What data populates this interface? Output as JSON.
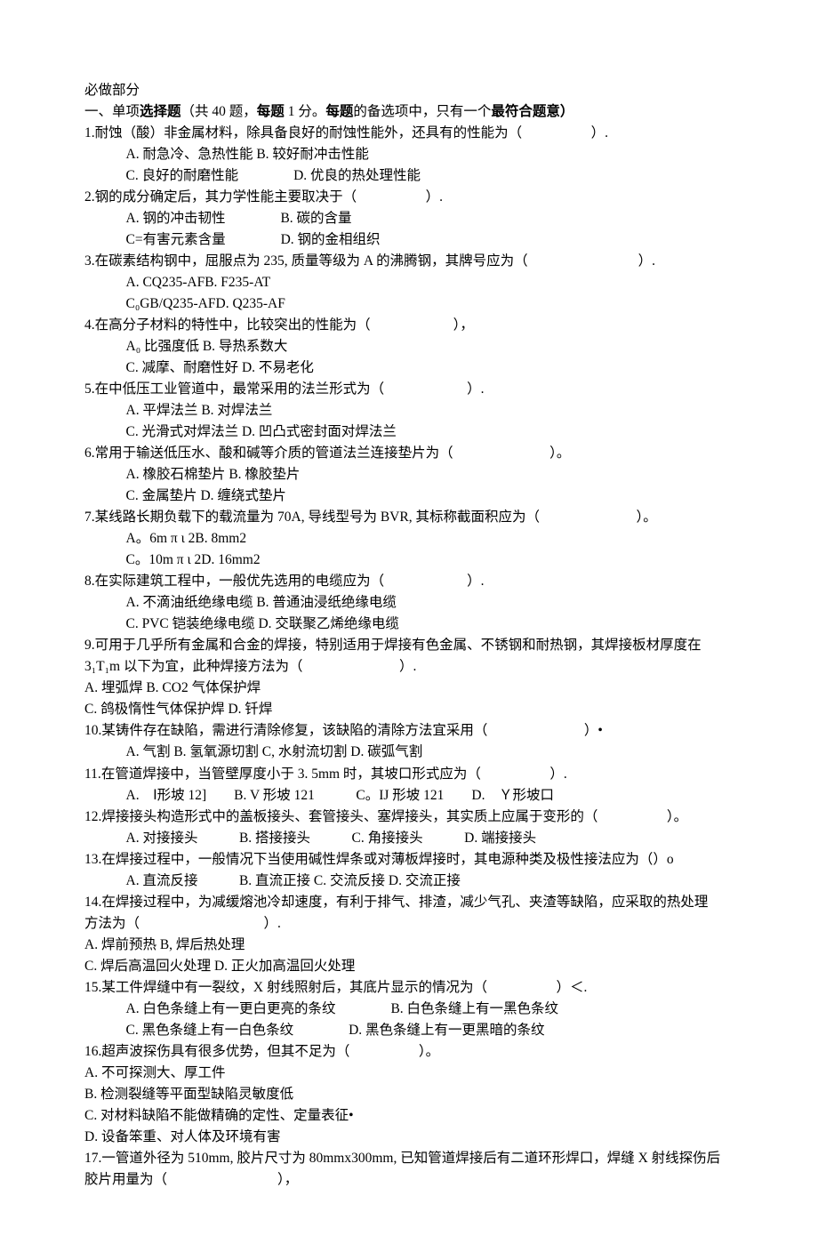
{
  "header": {
    "title": "必做部分",
    "intro_prefix": "一、单项",
    "intro_bold1": "选择题",
    "intro_mid": "（共 40 题，",
    "intro_bold2": "每题",
    "intro_mid2": " 1 分。",
    "intro_bold3": "每题",
    "intro_mid3": "的备选项中，只有一个",
    "intro_bold4": "最符合题意）"
  },
  "questions": [
    {
      "n": "1.",
      "text": "耐蚀（酸）非金属材料，除具备良好的耐蚀性能外，还具有的性能为（　　　　　）.",
      "opts": [
        "A. 耐急冷、急热性能 B. 较好耐冲击性能",
        "C. 良好的耐磨性能　　　　D. 优良的热处理性能"
      ]
    },
    {
      "n": "2.",
      "text": "钢的成分确定后，其力学性能主要取决于（　　　　　）.",
      "opts": [
        "A. 钢的冲击韧性　　　　B. 碳的含量",
        "C=有害元素含量　　　　D. 钢的金相组织"
      ]
    },
    {
      "n": "3.",
      "text": "在碳素结构钢中，屈服点为 235, 质量等级为 A 的沸腾钢，其牌号应为（　　　　　　　　）.",
      "opts": [
        "A. CQ235-AFB. F235-AT",
        "C₀GB/Q235-AFD. Q235-AF"
      ]
    },
    {
      "n": "4.",
      "text": "在高分子材料的特性中，比较突出的性能为（　　　　　　），",
      "opts": [
        "A₀ 比强度低 B. 导热系数大",
        "C. 减摩、耐磨性好 D. 不易老化"
      ]
    },
    {
      "n": "5.",
      "text": "在中低压工业管道中，最常采用的法兰形式为（　　　　　　）.",
      "opts": [
        "A. 平焊法兰 B. 对焊法兰",
        "C. 光滑式对焊法兰 D. 凹凸式密封面对焊法兰"
      ]
    },
    {
      "n": "6.",
      "text": "常用于输送低压水、酸和碱等介质的管道法兰连接垫片为（　　　　　　　）。",
      "opts": [
        "A. 橡胶石棉垫片 B. 橡胶垫片",
        "C. 金属垫片 D. 缠绕式垫片"
      ]
    },
    {
      "n": "7.",
      "text": "某线路长期负载下的载流量为 70A, 导线型号为 BVR, 其标称截面积应为（　　　　　　　）。",
      "opts": [
        "A。6m π ι 2B. 8mm2",
        "C。10m π ι 2D. 16mm2"
      ]
    },
    {
      "n": "8.",
      "text": "在实际建筑工程中，一般优先选用的电缆应为（　　　　　　）.",
      "opts": [
        "A. 不滴油纸绝缘电缆 B. 普通油浸纸绝缘电缆",
        "C. PVC 铠装绝缘电缆 D. 交联聚乙烯绝缘电缆"
      ]
    },
    {
      "n": "9.",
      "text": "可用于几乎所有金属和合金的焊接，特别适用于焊接有色金属、不锈钢和耐热钢，其焊接板材厚度在",
      "cont": "3₁T₁m 以下为宜，此种焊接方法为（　　　　　　　）.",
      "opts": [
        "A. 埋弧焊 B. CO2 气体保护焊",
        "C. 鸽极惰性气体保护焊 D. 钎焊"
      ],
      "noindent": true
    },
    {
      "n": "10.",
      "text": "某铸件存在缺陷，需进行清除修复，该缺陷的清除方法宜采用（　　　　　　　）•",
      "opts": [
        "A. 气割 B. 氢氧源切割 C, 水射流切割 D. 碳弧气割"
      ]
    },
    {
      "n": "11.",
      "text": "在管道焊接中，当管壁厚度小于 3. 5mm 时，其坡口形式应为（　　　　　）.",
      "opts": [
        "A.　Ⅰ形坡 12]　　B. V 形坡 121　　　C。IJ 形坡 121　　D.　Ｙ形坡口"
      ]
    },
    {
      "n": "12.",
      "text": "焊接接头构造形式中的盖板接头、套管接头、塞焊接头，其实质上应属于变形的（　　　　　）。",
      "opts": [
        "A. 对接接头　　　B. 搭接接头　　　C. 角接接头　　　D. 端接接头"
      ]
    },
    {
      "n": "13.",
      "text": "在焊接过程中，一般情况下当使用碱性焊条或对薄板焊接时，其电源种类及极性接法应为（）o",
      "opts": [
        "A. 直流反接　　　B. 直流正接 C. 交流反接 D. 交流正接"
      ]
    },
    {
      "n": "14.",
      "text": "在焊接过程中，为减缓熔池冷却速度，有利于排气、排渣，减少气孔、夹渣等缺陷，应采取的热处理",
      "cont": "方法为（　　　　　　　　　）.",
      "opts": [
        "A. 焊前预热 B, 焊后热处理",
        "C. 焊后高温回火处理 D. 正火加高温回火处理"
      ],
      "noindent": true
    },
    {
      "n": "15.",
      "text": "某工件焊缝中有一裂纹，X 射线照射后，其底片显示的情况为（　　　　　）＜.",
      "opts": [
        "A. 白色条缝上有一更白更亮的条纹　　　　B. 白色条缝上有一黑色条纹",
        "C. 黑色条缝上有一白色条纹　　　　D. 黑色条缝上有一更黑暗的条纹"
      ]
    },
    {
      "n": "16.",
      "text": "超声波探伤具有很多优势，但其不足为（　　　　　）。",
      "opts": [
        "A. 不可探测大、厚工件",
        "B. 检测裂缝等平面型缺陷灵敏度低",
        "C. 对材料缺陷不能做精确的定性、定量表征•",
        "D. 设备笨重、对人体及环境有害"
      ],
      "noindent": true
    },
    {
      "n": "17.",
      "text": "一管道外径为 510mm, 胶片尺寸为 80mmx300mm, 已知管道焊接后有二道环形焊口，焊缝 X 射线探伤后",
      "cont": "胶片用量为（　　　　　　　　），",
      "opts": [],
      "noindent": true
    }
  ]
}
